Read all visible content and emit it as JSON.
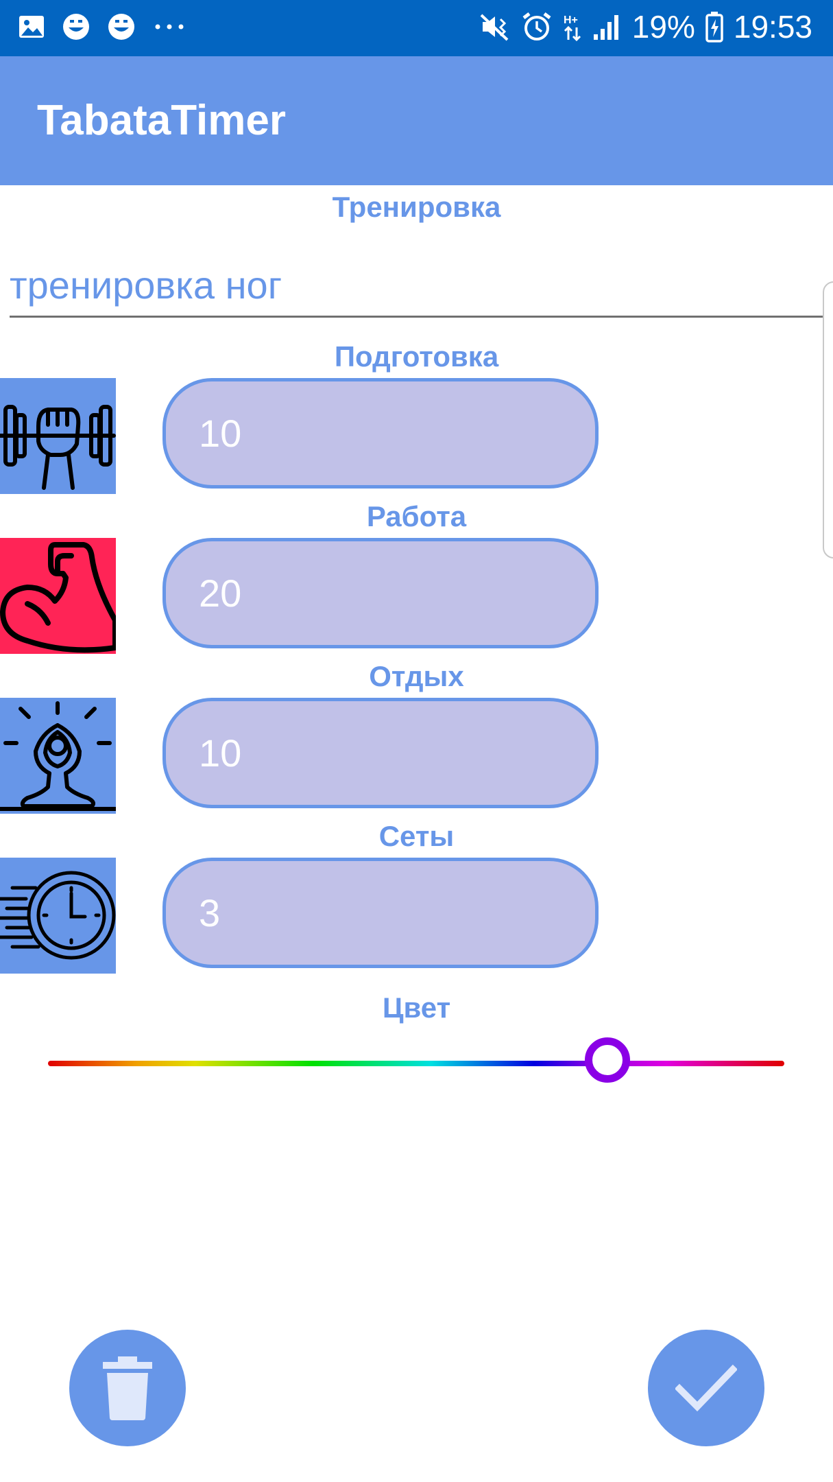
{
  "status_bar": {
    "battery_percent": "19%",
    "time": "19:53",
    "left_icons": [
      "image-icon",
      "smiley-icon",
      "smiley-icon",
      "more-dots-icon"
    ],
    "right_icons": [
      "mute-vibrate-icon",
      "alarm-icon",
      "data-arrows-icon",
      "signal-icon",
      "battery-icon"
    ]
  },
  "app_bar": {
    "title": "TabataTimer"
  },
  "workout": {
    "label": "Тренировка",
    "name_value": "тренировка ног"
  },
  "fields": [
    {
      "label": "Подготовка",
      "value": "10",
      "icon": "dumbbell-icon",
      "icon_bg": "#6796e8"
    },
    {
      "label": "Работа",
      "value": "20",
      "icon": "biceps-icon",
      "icon_bg": "#ff2456"
    },
    {
      "label": "Отдых",
      "value": "10",
      "icon": "meditation-icon",
      "icon_bg": "#6796e8"
    },
    {
      "label": "Сеты",
      "value": "3",
      "icon": "fast-clock-icon",
      "icon_bg": "#6796e8"
    }
  ],
  "color": {
    "label": "Цвет",
    "slider_position": 0.77,
    "selected_color": "#8a00e6"
  },
  "actions": {
    "delete_icon": "trash-icon",
    "confirm_icon": "check-icon"
  },
  "colors": {
    "status_bar": "#0365c1",
    "accent": "#6796e8",
    "field_fill": "#c1c1e8"
  }
}
